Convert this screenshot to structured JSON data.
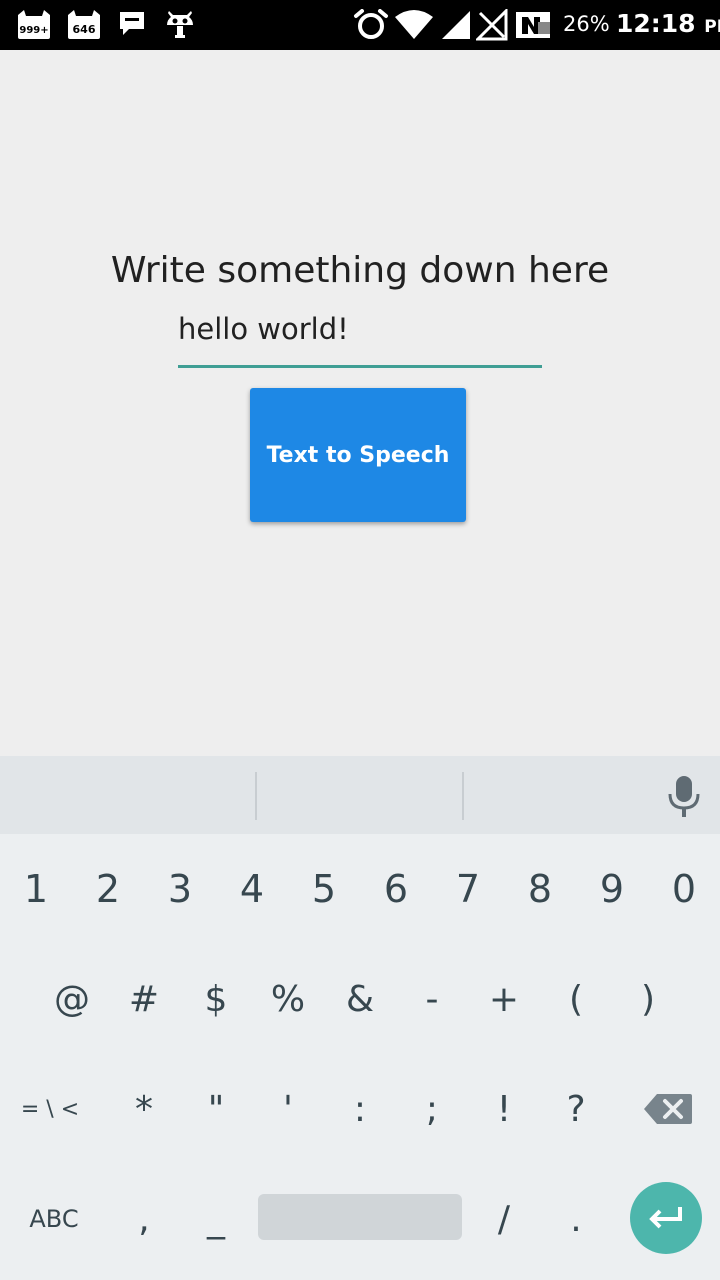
{
  "status_bar": {
    "notifications": [
      {
        "icon": "cat-badge-icon",
        "badge": "999+"
      },
      {
        "icon": "cat-badge-icon",
        "badge": "646"
      },
      {
        "icon": "chat-bubble-icon"
      },
      {
        "icon": "android-robot-icon"
      }
    ],
    "system_icons": [
      "alarm-icon",
      "wifi-icon",
      "cell-signal-icon",
      "no-signal-icon",
      "data-off-icon"
    ],
    "battery": "26%",
    "time": "12:18",
    "ampm": "PM"
  },
  "app": {
    "prompt": "Write something down here",
    "input": {
      "value": "hello world!"
    },
    "button": {
      "label": "Text to Speech",
      "color": "#1e88e5"
    },
    "accent_color": "#3f9e94"
  },
  "keyboard": {
    "suggestions": [
      "",
      "",
      ""
    ],
    "row1": [
      "1",
      "2",
      "3",
      "4",
      "5",
      "6",
      "7",
      "8",
      "9",
      "0"
    ],
    "row2": [
      "@",
      "#",
      "$",
      "%",
      "&",
      "-",
      "+",
      "(",
      ")"
    ],
    "row3": {
      "more_symbols": "= \\ <",
      "keys": [
        "*",
        "\"",
        "'",
        ":",
        ";",
        "!",
        "?"
      ]
    },
    "row4": {
      "abc": "ABC",
      "comma": ",",
      "underscore": "_",
      "slash": "/",
      "period": "."
    },
    "enter_color": "#4db6ac"
  }
}
